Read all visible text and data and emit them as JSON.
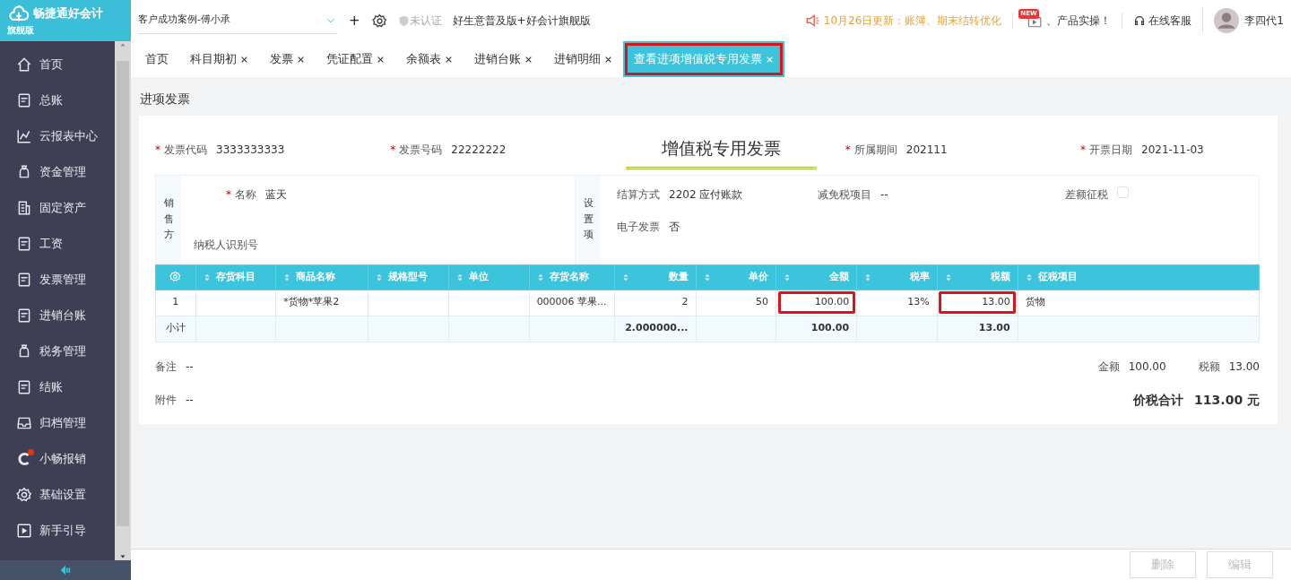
{
  "logo": {
    "title": "畅捷通好会计",
    "edition": "旗舰版"
  },
  "topbar": {
    "company": "客户成功案例-傅小承",
    "add_icon": "+",
    "verify": "未认证",
    "product": "好生意普及版+好会计旗舰版",
    "notice": "10月26日更新：账簿、期末结转优化",
    "new_badge": "NEW",
    "promo": "、产品实操！",
    "support": "在线客服",
    "user": "李四代1"
  },
  "sidebar": {
    "items": [
      {
        "label": "首页",
        "badge": false
      },
      {
        "label": "总账",
        "badge": false
      },
      {
        "label": "云报表中心",
        "badge": false
      },
      {
        "label": "资金管理",
        "badge": false
      },
      {
        "label": "固定资产",
        "badge": false
      },
      {
        "label": "工资",
        "badge": false
      },
      {
        "label": "发票管理",
        "badge": false
      },
      {
        "label": "进销台账",
        "badge": false
      },
      {
        "label": "税务管理",
        "badge": false
      },
      {
        "label": "结账",
        "badge": false
      },
      {
        "label": "归档管理",
        "badge": false
      },
      {
        "label": "小畅报销",
        "badge": true
      },
      {
        "label": "基础设置",
        "badge": false
      },
      {
        "label": "新手引导",
        "badge": false
      }
    ]
  },
  "tabs": [
    {
      "label": "首页",
      "closable": false,
      "selected": false,
      "highlighted": false
    },
    {
      "label": "科目期初",
      "closable": true,
      "selected": false,
      "highlighted": false
    },
    {
      "label": "发票",
      "closable": true,
      "selected": false,
      "highlighted": false
    },
    {
      "label": "凭证配置",
      "closable": true,
      "selected": false,
      "highlighted": false
    },
    {
      "label": "余额表",
      "closable": true,
      "selected": false,
      "highlighted": false
    },
    {
      "label": "进销台账",
      "closable": true,
      "selected": false,
      "highlighted": false
    },
    {
      "label": "进销明细",
      "closable": true,
      "selected": false,
      "highlighted": false
    },
    {
      "label": "查看进项增值税专用发票",
      "closable": true,
      "selected": true,
      "highlighted": true
    }
  ],
  "page_title": "进项发票",
  "invoice": {
    "title": "增值税专用发票",
    "head_fields": [
      {
        "required_mark": "*",
        "label": "发票代码",
        "value": "3333333333"
      },
      {
        "required_mark": "*",
        "label": "发票号码",
        "value": "22222222"
      },
      {
        "required_mark": "*",
        "label": "所属期间",
        "value": "202111"
      },
      {
        "required_mark": "*",
        "label": "开票日期",
        "value": "2021-11-03"
      }
    ],
    "seller": {
      "title": "销售方",
      "name_required_mark": "*",
      "name_label": "名称",
      "name_value": "蓝天",
      "tax_id_label": "纳税人识别号"
    },
    "settings": {
      "title": "设置项",
      "settlement_label": "结算方式",
      "settlement_value": "2202 应付账款",
      "exempt_label": "减免税项目",
      "exempt_value": "--",
      "diff_label": "差额征税",
      "diff_checked": false,
      "einvoice_label": "电子发票",
      "einvoice_value": "否"
    }
  },
  "table": {
    "columns": [
      "存货科目",
      "商品名称",
      "规格型号",
      "单位",
      "存货名称",
      "数量",
      "单价",
      "金额",
      "税率",
      "税额",
      "征税项目"
    ],
    "rows": [
      {
        "index": "1",
        "cells": [
          {
            "text": "",
            "highlighted": false
          },
          {
            "text": "*货物*苹果2",
            "highlighted": false
          },
          {
            "text": "",
            "highlighted": false
          },
          {
            "text": "",
            "highlighted": false
          },
          {
            "text": "000006 苹果...",
            "highlighted": false
          },
          {
            "text": "2",
            "highlighted": false
          },
          {
            "text": "50",
            "highlighted": false
          },
          {
            "text": "100.00",
            "highlighted": true
          },
          {
            "text": "13%",
            "highlighted": false
          },
          {
            "text": "13.00",
            "highlighted": true
          },
          {
            "text": "货物",
            "highlighted": false
          }
        ]
      }
    ],
    "subtotal": {
      "label": "小计",
      "cells": [
        "",
        "",
        "",
        "",
        "",
        "2.000000...",
        "",
        "100.00",
        "",
        "13.00",
        ""
      ]
    }
  },
  "footer": {
    "remark_label": "备注",
    "remark_value": "--",
    "attach_label": "附件",
    "attach_value": "--",
    "amount_label": "金额",
    "amount_value": "100.00",
    "tax_label": "税额",
    "tax_value": "13.00",
    "total_label": "价税合计",
    "total_value": "113.00 元"
  },
  "buttons": [
    {
      "label": "删除",
      "disabled": true
    },
    {
      "label": "编辑",
      "disabled": true
    }
  ]
}
